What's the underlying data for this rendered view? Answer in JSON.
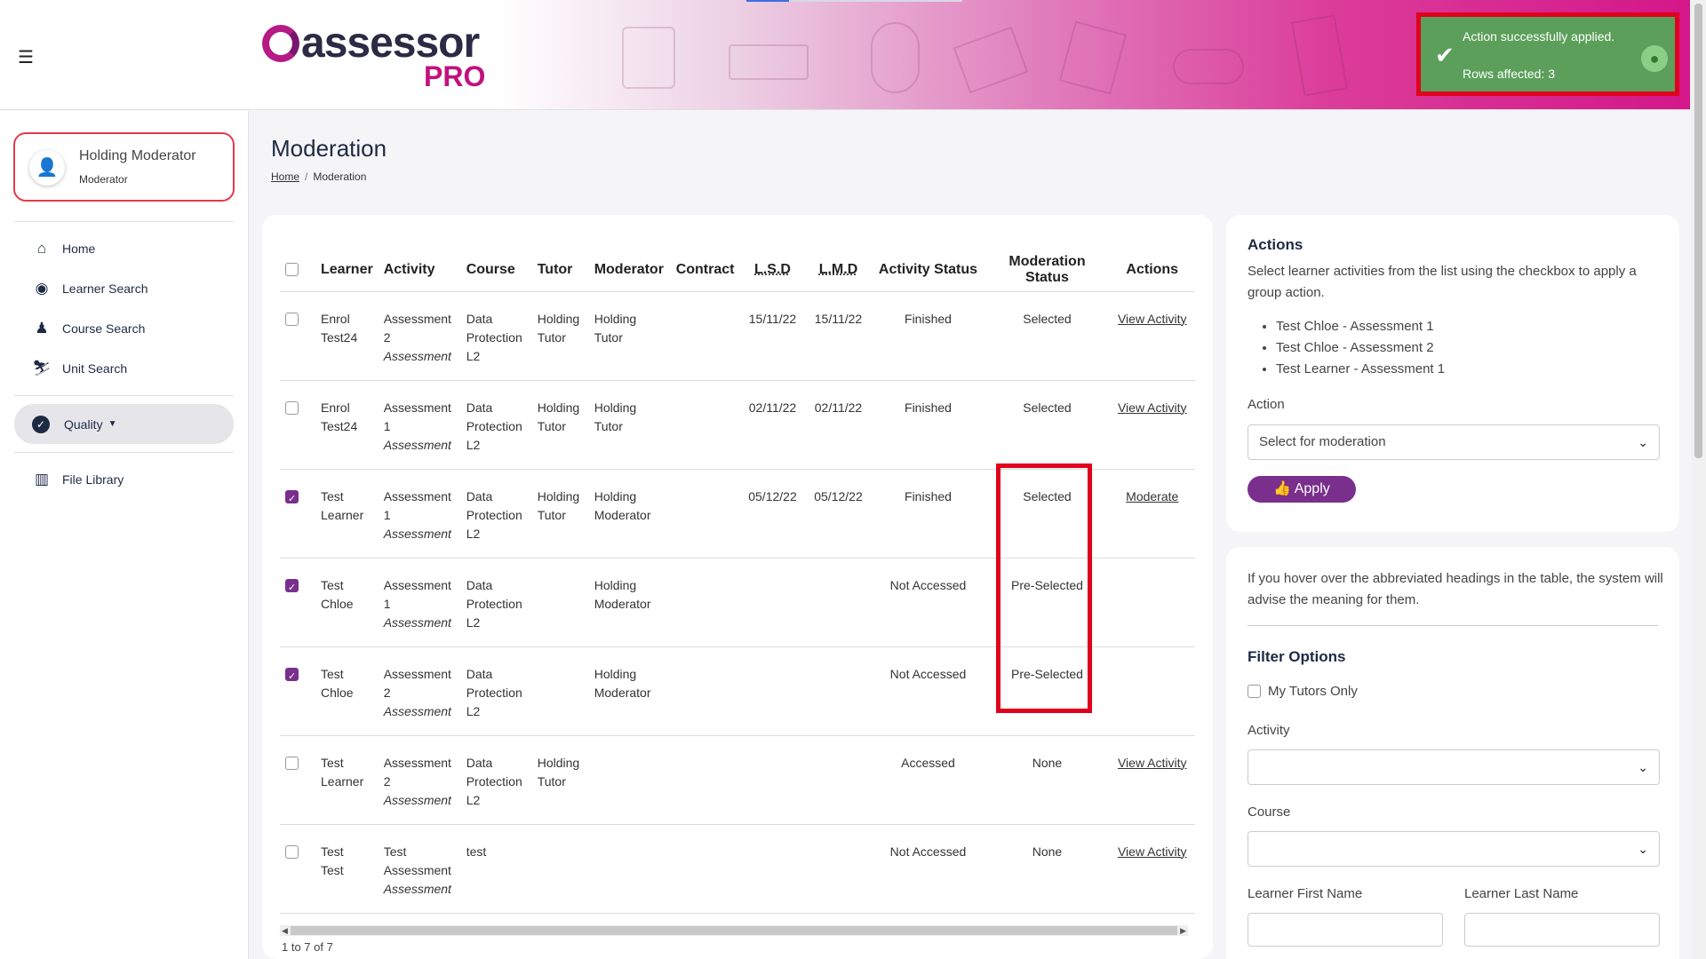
{
  "header": {
    "menu_icon": "hamburger-icon",
    "logo_main": "assessor",
    "logo_pro": "PRO"
  },
  "toast": {
    "message": "Action successfully applied.",
    "rows": "Rows affected: 3",
    "icon": "check-icon",
    "bg_color": "#5b9f5a"
  },
  "sidebar": {
    "user_name": "Holding Moderator",
    "user_role": "Moderator",
    "items": [
      {
        "label": "Home",
        "icon": "home-icon"
      },
      {
        "label": "Learner Search",
        "icon": "user-circle-icon"
      },
      {
        "label": "Course Search",
        "icon": "graduate-icon"
      },
      {
        "label": "Unit Search",
        "icon": "skier-icon"
      }
    ],
    "quality_label": "Quality",
    "file_library_label": "File Library"
  },
  "page": {
    "title": "Moderation",
    "breadcrumb_home": "Home",
    "breadcrumb_current": "Moderation"
  },
  "table": {
    "headers": [
      "Learner",
      "Activity",
      "Course",
      "Tutor",
      "Moderator",
      "Contract",
      "L.S.D",
      "L.M.D",
      "Activity Status",
      "Moderation Status",
      "Actions"
    ],
    "rows": [
      {
        "checked": false,
        "learner": [
          "Enrol",
          "Test24"
        ],
        "activity": [
          "Assessment",
          "2"
        ],
        "type": "Assessment",
        "course": [
          "Data",
          "Protection",
          "L2"
        ],
        "tutor": [
          "Holding",
          "Tutor"
        ],
        "moderator": [
          "Holding",
          "Tutor"
        ],
        "contract": "",
        "lsd": "15/11/22",
        "lmd": "15/11/22",
        "activity_status": "Finished",
        "moderation_status": "Selected",
        "action": "View Activity"
      },
      {
        "checked": false,
        "learner": [
          "Enrol",
          "Test24"
        ],
        "activity": [
          "Assessment",
          "1"
        ],
        "type": "Assessment",
        "course": [
          "Data",
          "Protection",
          "L2"
        ],
        "tutor": [
          "Holding",
          "Tutor"
        ],
        "moderator": [
          "Holding",
          "Tutor"
        ],
        "contract": "",
        "lsd": "02/11/22",
        "lmd": "02/11/22",
        "activity_status": "Finished",
        "moderation_status": "Selected",
        "action": "View Activity"
      },
      {
        "checked": true,
        "learner": [
          "Test",
          "Learner"
        ],
        "activity": [
          "Assessment",
          "1"
        ],
        "type": "Assessment",
        "course": [
          "Data",
          "Protection",
          "L2"
        ],
        "tutor": [
          "Holding",
          "Tutor"
        ],
        "moderator": [
          "Holding",
          "Moderator"
        ],
        "contract": "",
        "lsd": "05/12/22",
        "lmd": "05/12/22",
        "activity_status": "Finished",
        "moderation_status": "Selected",
        "action": "Moderate"
      },
      {
        "checked": true,
        "learner": [
          "Test",
          "Chloe"
        ],
        "activity": [
          "Assessment",
          "1"
        ],
        "type": "Assessment",
        "course": [
          "Data",
          "Protection",
          "L2"
        ],
        "tutor": [
          "",
          ""
        ],
        "moderator": [
          "Holding",
          "Moderator"
        ],
        "contract": "",
        "lsd": "",
        "lmd": "",
        "activity_status": "Not Accessed",
        "moderation_status": "Pre-Selected",
        "action": ""
      },
      {
        "checked": true,
        "learner": [
          "Test",
          "Chloe"
        ],
        "activity": [
          "Assessment",
          "2"
        ],
        "type": "Assessment",
        "course": [
          "Data",
          "Protection",
          "L2"
        ],
        "tutor": [
          "",
          ""
        ],
        "moderator": [
          "Holding",
          "Moderator"
        ],
        "contract": "",
        "lsd": "",
        "lmd": "",
        "activity_status": "Not Accessed",
        "moderation_status": "Pre-Selected",
        "action": ""
      },
      {
        "checked": false,
        "learner": [
          "Test",
          "Learner"
        ],
        "activity": [
          "Assessment",
          "2"
        ],
        "type": "Assessment",
        "course": [
          "Data",
          "Protection",
          "L2"
        ],
        "tutor": [
          "Holding",
          "Tutor"
        ],
        "moderator": [
          "",
          ""
        ],
        "contract": "",
        "lsd": "",
        "lmd": "",
        "activity_status": "Accessed",
        "moderation_status": "None",
        "action": "View Activity"
      },
      {
        "checked": false,
        "learner": [
          "Test",
          "Test"
        ],
        "activity": [
          "Test",
          "Assessment"
        ],
        "type": "Assessment",
        "course": [
          "test",
          "",
          ""
        ],
        "tutor": [
          "",
          ""
        ],
        "moderator": [
          "",
          ""
        ],
        "contract": "",
        "lsd": "",
        "lmd": "",
        "activity_status": "Not Accessed",
        "moderation_status": "None",
        "action": "View Activity"
      }
    ],
    "paging": "1 to 7 of 7"
  },
  "actions_panel": {
    "title": "Actions",
    "description": "Select learner activities from the list using the checkbox to apply a group action.",
    "selected_items": [
      "Test Chloe - Assessment 1",
      "Test Chloe - Assessment 2",
      "Test Learner - Assessment 1"
    ],
    "action_label": "Action",
    "action_value": "Select for moderation",
    "apply_label": "Apply",
    "accent_color": "#7a2f8c"
  },
  "filter_panel": {
    "hint": "If you hover over the abbreviated headings in the table, the system will advise the meaning for them.",
    "title": "Filter Options",
    "my_tutors_label": "My Tutors Only",
    "activity_label": "Activity",
    "activity_value": "",
    "course_label": "Course",
    "course_value": "",
    "first_name_label": "Learner First Name",
    "last_name_label": "Learner Last Name"
  }
}
